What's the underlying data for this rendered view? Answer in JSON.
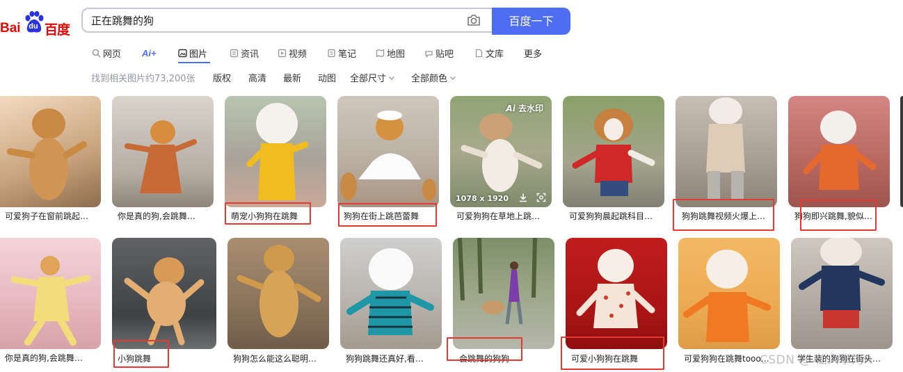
{
  "logo": {
    "bai": "Bai",
    "du": "du",
    "cn": "百度"
  },
  "search": {
    "query": "正在跳舞的狗",
    "button": "百度一下"
  },
  "tabs": [
    {
      "label": "网页",
      "icon": "search-icon"
    },
    {
      "label": "Ai+",
      "icon": "ai-icon"
    },
    {
      "label": "图片",
      "icon": "image-icon",
      "active": true
    },
    {
      "label": "资讯",
      "icon": "news-icon"
    },
    {
      "label": "视频",
      "icon": "video-icon"
    },
    {
      "label": "笔记",
      "icon": "note-icon"
    },
    {
      "label": "地图",
      "icon": "map-icon"
    },
    {
      "label": "贴吧",
      "icon": "tieba-icon"
    },
    {
      "label": "文库",
      "icon": "doc-icon"
    },
    {
      "label": "更多",
      "icon": ""
    }
  ],
  "filters": {
    "count": "找到相关图片约73,200张",
    "items": [
      "版权",
      "高清",
      "最新",
      "动图",
      "全部尺寸",
      "全部颜色"
    ]
  },
  "images": [
    {
      "caption": "可爱狗子在窗前跳起…",
      "highlighted": false
    },
    {
      "caption": "你是真的狗,会跳舞…",
      "highlighted": false
    },
    {
      "caption": "萌宠小狗狗在跳舞",
      "highlighted": true
    },
    {
      "caption": "狗狗在街上跳芭蕾舞",
      "highlighted": true
    },
    {
      "caption": "可爱狗狗在草地上跳…",
      "highlighted": false,
      "badge": "去水印",
      "size": "1078 x 1920"
    },
    {
      "caption": "可爱狗狗晨起跳科目…",
      "highlighted": false
    },
    {
      "caption": "狗狗跳舞视频火爆上…",
      "highlighted": true
    },
    {
      "caption": "狗狗即兴跳舞,貌似…",
      "highlighted": true
    },
    {
      "caption": "你是真的狗,会跳舞…",
      "highlighted": false
    },
    {
      "caption": "小狗跳舞",
      "highlighted": true
    },
    {
      "caption": "狗狗怎么能这么聪明…",
      "highlighted": false
    },
    {
      "caption": "狗狗跳舞还真好,看…",
      "highlighted": false
    },
    {
      "caption": "会跳舞的狗狗",
      "highlighted": true
    },
    {
      "caption": "可爱小狗狗在跳舞",
      "highlighted": true
    },
    {
      "caption": "可爱狗狗在跳舞tooo…",
      "highlighted": false
    },
    {
      "caption": "学生装的狗狗在街头…",
      "highlighted": false
    }
  ],
  "watermark": "CSDN @ 仙人掌河R"
}
